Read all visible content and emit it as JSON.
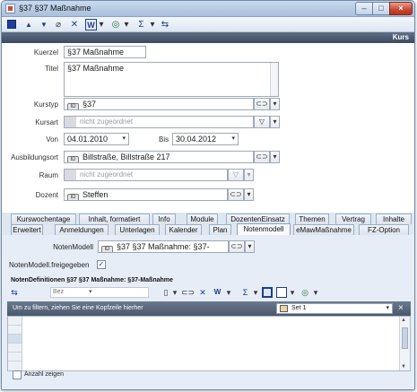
{
  "window": {
    "title": "§37 §37 Maßnahme",
    "buttons": {
      "minimize": "–",
      "maximize": "□",
      "close": "×"
    }
  },
  "toolbar": {
    "items": [
      "save-icon",
      "arrow-up-icon",
      "arrow-down-icon",
      "attach-icon",
      "delete-icon",
      "word-icon",
      "dropdown-icon",
      "web-icon",
      "dropdown-icon",
      "sum-icon",
      "dropdown-icon",
      "refresh-icon"
    ],
    "glyphs": {
      "up": "▲",
      "down": "▼",
      "attach": "⌀",
      "delete": "✕",
      "word": "W",
      "dd": "▾",
      "web": "◎",
      "sum": "Σ",
      "refresh": "⇆"
    }
  },
  "header": {
    "section_label": "Kurs"
  },
  "form": {
    "kuerzel": {
      "label": "Kuerzel",
      "value": "§37 Maßnahme"
    },
    "titel": {
      "label": "Titel",
      "value": "§37 Maßnahme"
    },
    "kurstyp": {
      "label": "Kurstyp",
      "value": "§37"
    },
    "kursart": {
      "label": "Kursart",
      "placeholder": "nicht zugeordnet"
    },
    "von": {
      "label": "Von",
      "value": "04.01.2010"
    },
    "bis": {
      "label": "Bis",
      "value": "30.04.2012"
    },
    "ausbildungsort": {
      "label": "Ausbildungsort",
      "value": "Billstraße, Billstraße 217"
    },
    "raum": {
      "label": "Raum",
      "placeholder": "nicht zugeordnet"
    },
    "dozent": {
      "label": "Dozent",
      "value": "Steffen"
    },
    "badge": "ID",
    "glyphs": {
      "folder": "⊂⊃",
      "dd": "▾",
      "funnel": "▽"
    }
  },
  "tabs": {
    "row1": [
      "Kurswochentage",
      "Inhalt, formatiert",
      "Info",
      "Module",
      "DozentenEinsatz",
      "Themen",
      "Vertrag",
      "Inhalte"
    ],
    "row2": [
      "Erweitert",
      "Anmeldungen",
      "Unterlagen",
      "Kalender",
      "Plan",
      "Notenmodell",
      "eMawMaßnahme",
      "FZ-Option"
    ],
    "active": "Notenmodell"
  },
  "notenmodell": {
    "label": "NotenModell",
    "value": "§37 §37 Maßnahme: §37-",
    "freigegeben_label": "NotenModell.freigegeben",
    "freigegeben_checked": true,
    "check_glyph": "✓",
    "definitionen_title": "NotenDefinitionen §37 §37 Maßnahme: §37-Maßnahme"
  },
  "grid": {
    "column_label": "Bez",
    "group_hint": "Um zu filtern, ziehen Sie eine Kopfzeile hierher",
    "set_label": "Set 1",
    "close_glyph": "×",
    "up_arrow": "▲",
    "down_arrow": "▼",
    "anzahl_label": "Anzahl zeigen",
    "anzahl_checked": false
  }
}
